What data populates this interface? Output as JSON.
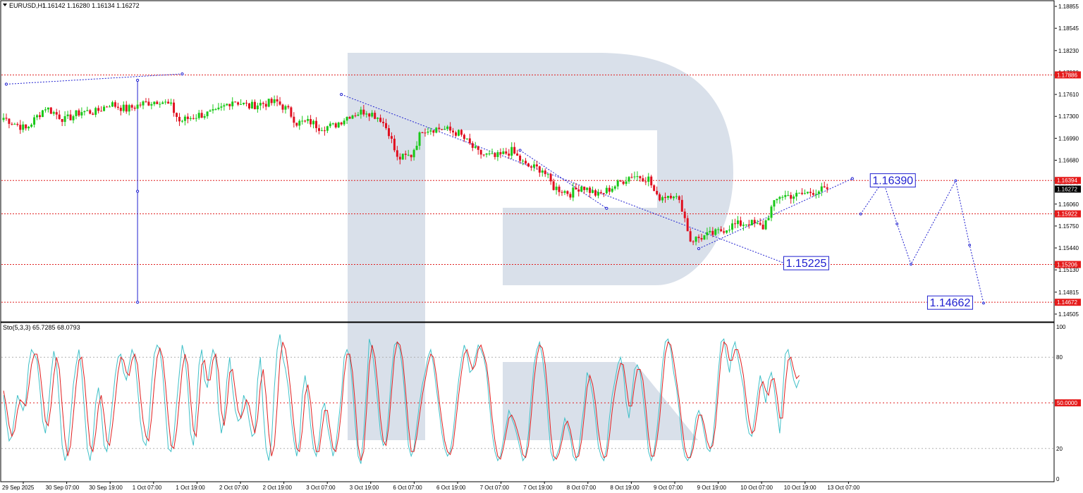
{
  "header": {
    "symbol": "EURUSD,H1",
    "ohlc": "1.16142 1.16280 1.16134 1.16272"
  },
  "colors": {
    "bull": "#18c818",
    "bear": "#e01020",
    "level_line": "#e02020",
    "forecast": "#2020d0",
    "stoch_main": "#40c0c8",
    "stoch_signal": "#e02020",
    "watermark": "#d5dde8",
    "tag_red": "#e51a1a",
    "tag_black": "#000000"
  },
  "chart_data": [
    {
      "type": "candlestick",
      "title": "EURUSD,H1",
      "ylim": [
        1.14405,
        1.18925
      ],
      "y_ticks": [
        "1.18855",
        "1.18545",
        "1.18230",
        "1.17920",
        "1.17610",
        "1.17300",
        "1.16990",
        "1.16680",
        "1.16370",
        "1.16060",
        "1.15750",
        "1.15440",
        "1.15130",
        "1.14815",
        "1.14505"
      ],
      "x_ticks": [
        "29 Sep 2025",
        "30 Sep 07:00",
        "30 Sep 19:00",
        "1 Oct 07:00",
        "1 Oct 19:00",
        "2 Oct 07:00",
        "2 Oct 19:00",
        "3 Oct 07:00",
        "3 Oct 19:00",
        "6 Oct 07:00",
        "6 Oct 19:00",
        "7 Oct 07:00",
        "7 Oct 19:00",
        "8 Oct 07:00",
        "8 Oct 19:00",
        "9 Oct 07:00",
        "9 Oct 19:00",
        "10 Oct 07:00",
        "10 Oct 19:00",
        "13 Oct 07:00"
      ],
      "last_price": "1.16272",
      "levels": [
        {
          "value": 1.17886,
          "label": "1.17886",
          "tag": "red"
        },
        {
          "value": 1.16394,
          "label": "1.16394",
          "tag": "red"
        },
        {
          "value": 1.15922,
          "label": "1.15922",
          "tag": "red"
        },
        {
          "value": 1.15206,
          "label": "1.15206",
          "tag": "red"
        },
        {
          "value": 1.14672,
          "label": "1.14672",
          "tag": "red"
        }
      ],
      "anchors": [
        {
          "bar": 0,
          "close": 1.1728
        },
        {
          "bar": 8,
          "close": 1.1712
        },
        {
          "bar": 15,
          "close": 1.1743
        },
        {
          "bar": 22,
          "close": 1.1725
        },
        {
          "bar": 28,
          "close": 1.1737
        },
        {
          "bar": 33,
          "close": 1.1736
        },
        {
          "bar": 38,
          "close": 1.1748
        },
        {
          "bar": 44,
          "close": 1.174
        },
        {
          "bar": 50,
          "close": 1.1748
        },
        {
          "bar": 56,
          "close": 1.1753
        },
        {
          "bar": 60,
          "close": 1.1744
        },
        {
          "bar": 63,
          "close": 1.1723
        },
        {
          "bar": 70,
          "close": 1.1732
        },
        {
          "bar": 76,
          "close": 1.1735
        },
        {
          "bar": 82,
          "close": 1.1753
        },
        {
          "bar": 88,
          "close": 1.1744
        },
        {
          "bar": 92,
          "close": 1.1748
        },
        {
          "bar": 98,
          "close": 1.175
        },
        {
          "bar": 102,
          "close": 1.1738
        },
        {
          "bar": 105,
          "close": 1.1721
        },
        {
          "bar": 110,
          "close": 1.1722
        },
        {
          "bar": 113,
          "close": 1.1715
        },
        {
          "bar": 118,
          "close": 1.1716
        },
        {
          "bar": 124,
          "close": 1.1732
        },
        {
          "bar": 130,
          "close": 1.1738
        },
        {
          "bar": 135,
          "close": 1.1727
        },
        {
          "bar": 138,
          "close": 1.1708
        },
        {
          "bar": 141,
          "close": 1.167
        },
        {
          "bar": 146,
          "close": 1.1675
        },
        {
          "bar": 150,
          "close": 1.1712
        },
        {
          "bar": 157,
          "close": 1.1713
        },
        {
          "bar": 163,
          "close": 1.1706
        },
        {
          "bar": 170,
          "close": 1.1678
        },
        {
          "bar": 176,
          "close": 1.1672
        },
        {
          "bar": 182,
          "close": 1.1681
        },
        {
          "bar": 187,
          "close": 1.166
        },
        {
          "bar": 193,
          "close": 1.1655
        },
        {
          "bar": 197,
          "close": 1.163
        },
        {
          "bar": 203,
          "close": 1.1621
        },
        {
          "bar": 207,
          "close": 1.1632
        },
        {
          "bar": 213,
          "close": 1.1618
        },
        {
          "bar": 219,
          "close": 1.1632
        },
        {
          "bar": 225,
          "close": 1.1647
        },
        {
          "bar": 231,
          "close": 1.1642
        },
        {
          "bar": 234,
          "close": 1.1615
        },
        {
          "bar": 240,
          "close": 1.1621
        },
        {
          "bar": 243,
          "close": 1.1601
        },
        {
          "bar": 246,
          "close": 1.1555
        },
        {
          "bar": 249,
          "close": 1.1558
        },
        {
          "bar": 255,
          "close": 1.1565
        },
        {
          "bar": 261,
          "close": 1.1576
        },
        {
          "bar": 267,
          "close": 1.158
        },
        {
          "bar": 272,
          "close": 1.1573
        },
        {
          "bar": 275,
          "close": 1.16
        },
        {
          "bar": 278,
          "close": 1.1618
        },
        {
          "bar": 284,
          "close": 1.1618
        },
        {
          "bar": 290,
          "close": 1.1624
        },
        {
          "bar": 295,
          "close": 1.16272
        }
      ],
      "trend_lines": [
        {
          "points": [
            [
              1,
              1.17755
            ],
            [
              64,
              1.179
            ]
          ]
        },
        {
          "points": [
            [
              121,
              1.1761
            ],
            [
              280,
              1.1522
            ]
          ]
        },
        {
          "points": [
            [
              185,
              1.1682
            ],
            [
              216,
              1.16
            ]
          ]
        },
        {
          "points": [
            [
              249,
              1.1543
            ],
            [
              304,
              1.1642
            ]
          ]
        }
      ],
      "projection": {
        "points": [
          [
            307,
            1.1592
          ],
          [
            315,
            1.1639
          ],
          [
            320,
            1.1578
          ],
          [
            325,
            1.1521
          ],
          [
            341,
            1.1639
          ],
          [
            346,
            1.1548
          ],
          [
            351,
            1.1466
          ]
        ],
        "labels": [
          {
            "text": "1.16390",
            "bar": 318.5,
            "value": 1.1639
          },
          {
            "text": "1.15225",
            "bar": 287.5,
            "value": 1.1522
          },
          {
            "text": "1.14662",
            "bar": 339,
            "value": 1.14662
          }
        ]
      },
      "vertical_marker": {
        "bar": 48,
        "from": 1.1781,
        "to": 1.14672
      }
    },
    {
      "type": "line",
      "title": "Sto(5,3,3) 65.7285 68.0793",
      "ylim": [
        0,
        100
      ],
      "y_ticks": [
        "100",
        "80",
        "50.0000",
        "20",
        "0"
      ],
      "levels": [
        80,
        50,
        20
      ],
      "series": [
        {
          "role": "main",
          "values": [
            55,
            38,
            25,
            28,
            42,
            55,
            50,
            45,
            52,
            75,
            85,
            82,
            78,
            60,
            38,
            30,
            45,
            68,
            84,
            75,
            50,
            22,
            12,
            18,
            40,
            62,
            75,
            85,
            70,
            45,
            20,
            12,
            25,
            50,
            60,
            45,
            22,
            18,
            32,
            50,
            68,
            80,
            82,
            70,
            65,
            75,
            85,
            80,
            60,
            38,
            25,
            22,
            35,
            62,
            82,
            88,
            85,
            70,
            45,
            20,
            18,
            28,
            50,
            70,
            88,
            80,
            60,
            30,
            22,
            45,
            75,
            85,
            65,
            60,
            75,
            85,
            80,
            45,
            30,
            40,
            65,
            80,
            60,
            45,
            38,
            40,
            55,
            50,
            38,
            28,
            30,
            65,
            80,
            45,
            20,
            12,
            25,
            60,
            85,
            95,
            80,
            72,
            60,
            40,
            25,
            15,
            25,
            55,
            68,
            55,
            35,
            20,
            15,
            25,
            45,
            50,
            35,
            25,
            15,
            22,
            38,
            55,
            80,
            85,
            80,
            60,
            35,
            15,
            10,
            30,
            60,
            92,
            85,
            70,
            50,
            30,
            22,
            25,
            45,
            70,
            88,
            90,
            85,
            70,
            48,
            22,
            15,
            20,
            35,
            50,
            62,
            70,
            80,
            85,
            75,
            60,
            45,
            30,
            20,
            15,
            18,
            30,
            48,
            65,
            78,
            88,
            82,
            70,
            72,
            80,
            88,
            85,
            80,
            70,
            50,
            30,
            18,
            12,
            15,
            25,
            35,
            45,
            40,
            35,
            28,
            20,
            12,
            15,
            30,
            55,
            75,
            85,
            90,
            80,
            65,
            40,
            18,
            12,
            15,
            20,
            30,
            40,
            35,
            28,
            15,
            12,
            18,
            35,
            50,
            70,
            65,
            55,
            40,
            22,
            15,
            12,
            20,
            40,
            55,
            65,
            75,
            80,
            70,
            50,
            40,
            55,
            72,
            75,
            70,
            55,
            38,
            18,
            12,
            18,
            32,
            50,
            75,
            90,
            92,
            85,
            70,
            60,
            45,
            25,
            15,
            12,
            15,
            25,
            40,
            45,
            40,
            30,
            20,
            18,
            25,
            45,
            70,
            90,
            92,
            80,
            70,
            85,
            90,
            80,
            70,
            60,
            40,
            30,
            28,
            40,
            55,
            68,
            60,
            50,
            65,
            70,
            60,
            45,
            30,
            55,
            82,
            85,
            75,
            65,
            60,
            65
          ]
        },
        {
          "role": "signal",
          "values": [
            58,
            48,
            35,
            28,
            32,
            45,
            52,
            50,
            48,
            60,
            75,
            82,
            82,
            72,
            55,
            38,
            35,
            48,
            68,
            80,
            72,
            48,
            26,
            15,
            22,
            42,
            62,
            78,
            80,
            65,
            42,
            22,
            18,
            30,
            48,
            55,
            42,
            25,
            22,
            35,
            52,
            70,
            80,
            78,
            70,
            68,
            78,
            82,
            75,
            55,
            38,
            28,
            25,
            40,
            62,
            80,
            86,
            80,
            62,
            40,
            22,
            20,
            32,
            52,
            72,
            82,
            75,
            52,
            32,
            28,
            50,
            75,
            78,
            65,
            65,
            78,
            82,
            70,
            45,
            35,
            48,
            70,
            72,
            58,
            45,
            40,
            45,
            52,
            48,
            38,
            30,
            40,
            62,
            72,
            55,
            30,
            15,
            22,
            48,
            78,
            90,
            85,
            72,
            55,
            35,
            20,
            18,
            32,
            55,
            62,
            50,
            30,
            18,
            18,
            32,
            45,
            45,
            32,
            20,
            18,
            28,
            45,
            68,
            82,
            82,
            70,
            48,
            22,
            12,
            18,
            45,
            75,
            88,
            80,
            62,
            40,
            25,
            22,
            35,
            58,
            80,
            90,
            88,
            78,
            58,
            35,
            18,
            18,
            28,
            42,
            55,
            65,
            75,
            82,
            80,
            68,
            52,
            38,
            25,
            18,
            16,
            22,
            38,
            55,
            70,
            82,
            85,
            78,
            72,
            75,
            85,
            88,
            82,
            75,
            60,
            40,
            25,
            15,
            13,
            20,
            30,
            40,
            42,
            38,
            32,
            25,
            16,
            14,
            22,
            42,
            65,
            80,
            88,
            86,
            75,
            55,
            30,
            15,
            13,
            17,
            25,
            35,
            38,
            32,
            22,
            14,
            15,
            25,
            42,
            60,
            68,
            62,
            50,
            32,
            20,
            14,
            15,
            28,
            45,
            58,
            68,
            76,
            75,
            62,
            48,
            48,
            62,
            72,
            72,
            65,
            48,
            28,
            15,
            15,
            25,
            40,
            62,
            82,
            90,
            88,
            78,
            65,
            52,
            35,
            20,
            14,
            14,
            20,
            32,
            42,
            42,
            35,
            25,
            20,
            22,
            35,
            58,
            80,
            90,
            88,
            78,
            78,
            85,
            85,
            78,
            68,
            52,
            38,
            30,
            32,
            45,
            60,
            64,
            58,
            55,
            65,
            66,
            55,
            40,
            40,
            62,
            78,
            80,
            72,
            66,
            68
          ]
        }
      ]
    }
  ]
}
